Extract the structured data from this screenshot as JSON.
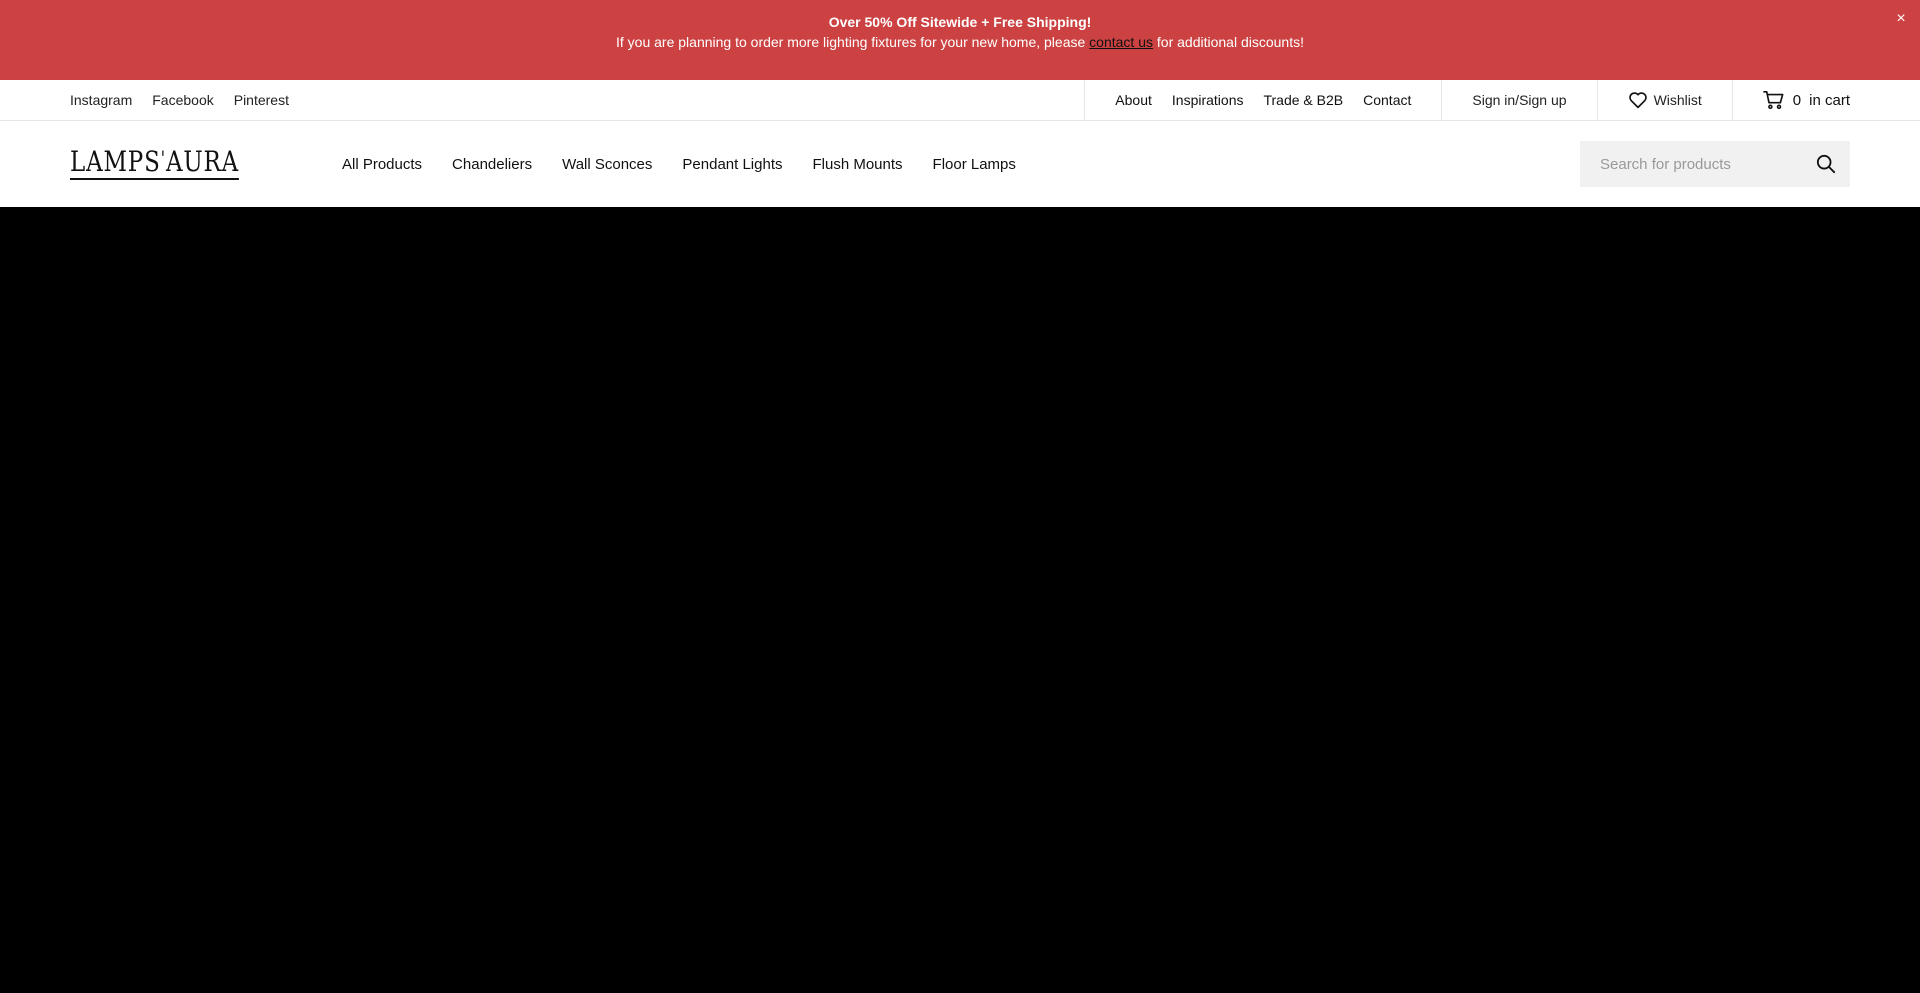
{
  "promo": {
    "title": "Over 50% Off Sitewide + Free Shipping!",
    "line_before": "If you are planning to order more lighting fixtures for your new home, please",
    "link_text": "contact us",
    "line_after": "for additional discounts!",
    "close": "×"
  },
  "utility": {
    "social": [
      "Instagram",
      "Facebook",
      "Pinterest"
    ],
    "pages": [
      "About",
      "Inspirations",
      "Trade & B2B",
      "Contact"
    ],
    "signin": "Sign in/Sign up",
    "wishlist": "Wishlist",
    "cart_count": "0",
    "cart_label": "in cart"
  },
  "header": {
    "logo_left": "LAMPS",
    "logo_mark": "'",
    "logo_right": "AURA",
    "nav": [
      "All Products",
      "Chandeliers",
      "Wall Sconces",
      "Pendant Lights",
      "Flush Mounts",
      "Floor Lamps"
    ],
    "search_placeholder": "Search for products"
  },
  "colors": {
    "promo_bg": "#cc4242",
    "hero_bg": "#000000"
  }
}
